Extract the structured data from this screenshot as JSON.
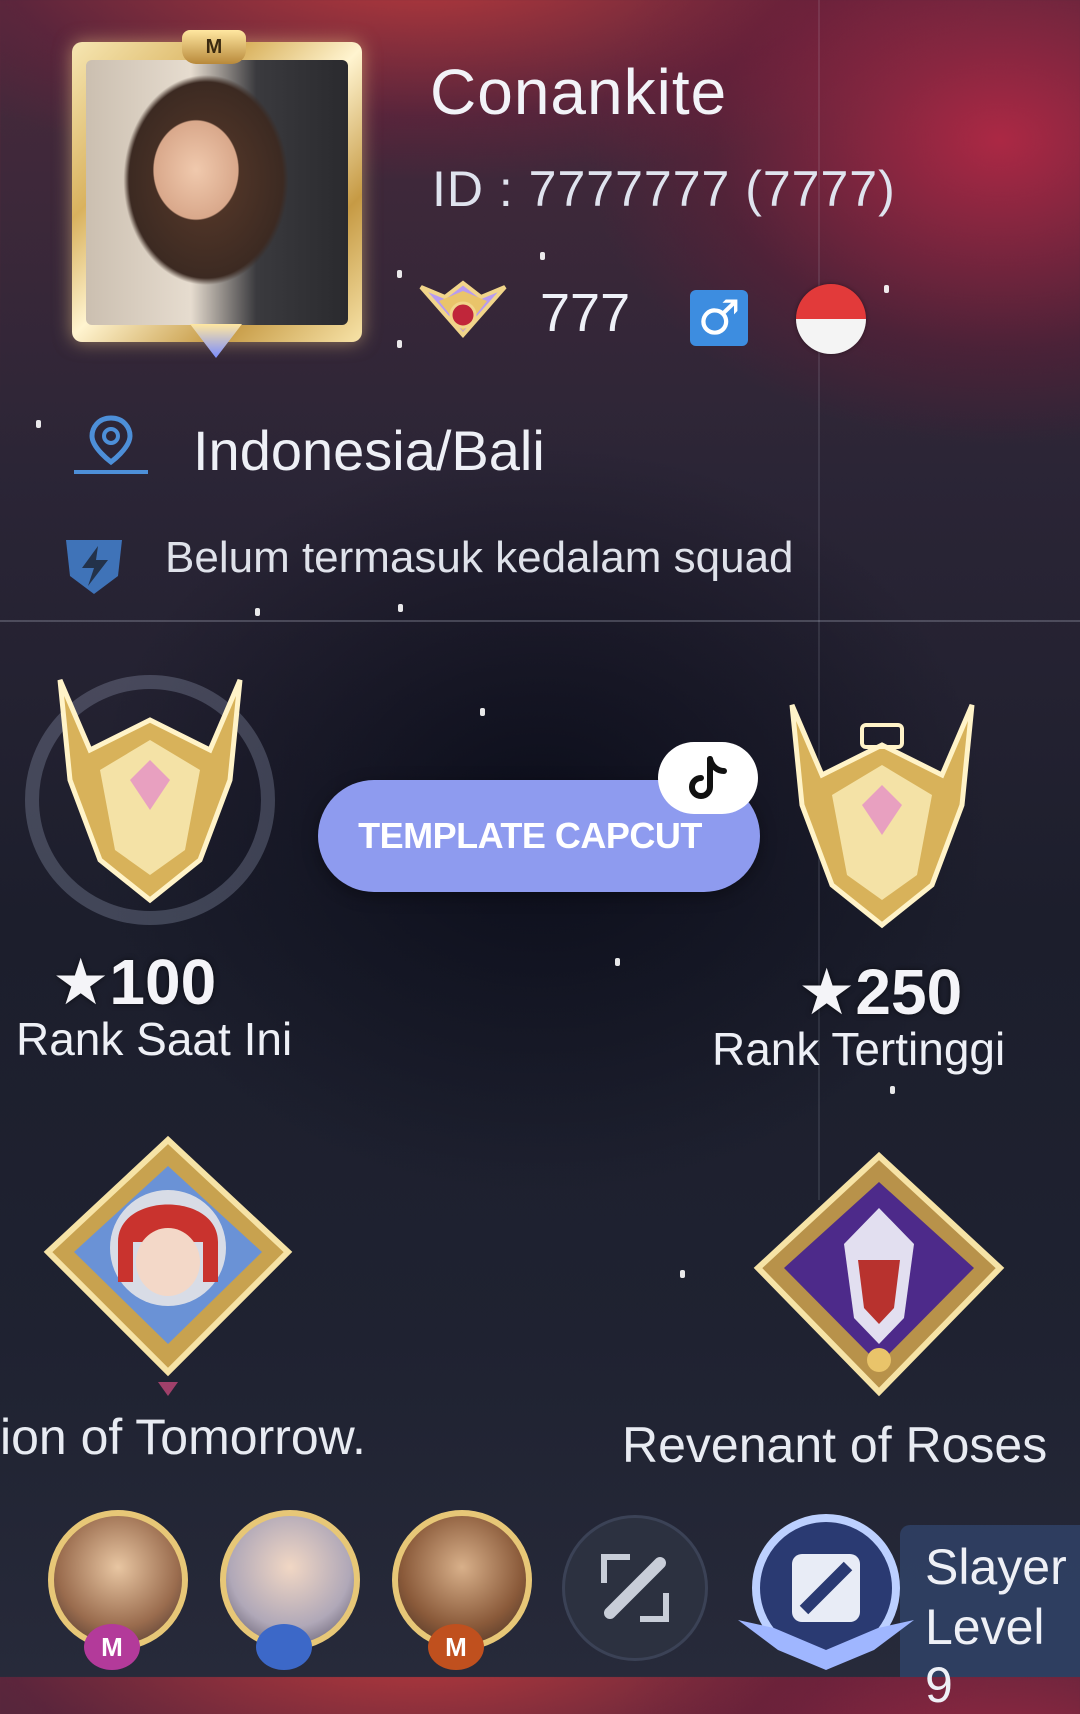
{
  "profile": {
    "name": "Conankite",
    "id_text": "ID : 7777777 (7777)",
    "level": "777",
    "gender_symbol": "♂",
    "location": "Indonesia/Bali",
    "squad_status": "Belum termasuk kedalam squad"
  },
  "ranks": {
    "current": {
      "stars": "100",
      "label": "Rank Saat Ini"
    },
    "highest": {
      "stars": "250",
      "label": "Rank Tertinggi"
    }
  },
  "overlay": {
    "pill_label": "TEMPLATE CAPCUT",
    "icon": "tiktok-icon"
  },
  "badges": {
    "left_label": "ion of Tomorrow.",
    "right_label": "Revenant of Roses"
  },
  "bottom": {
    "hero_tags": [
      "M",
      "",
      "M"
    ],
    "slayer_line1": "Slayer",
    "slayer_line2": "Level 9"
  },
  "colors": {
    "pill": "#8e9bef",
    "gender_badge": "#3d8de0",
    "flag_red": "#e23a3a",
    "flag_white": "#f4f4f4",
    "gold": "#d9b25e"
  }
}
